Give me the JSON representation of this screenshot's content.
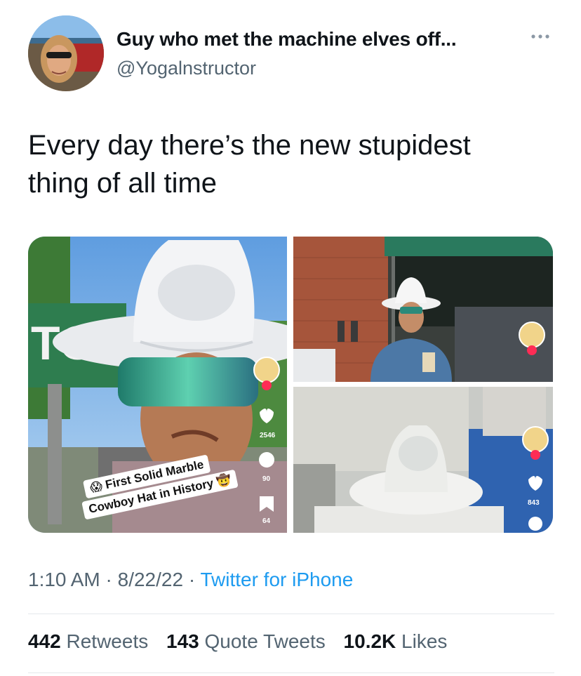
{
  "author": {
    "display_name": "Guy who met the machine elves off...",
    "handle": "@Yogalnstructor",
    "avatar_icon": "profile-photo"
  },
  "more_icon": "ellipsis-icon",
  "tweet": {
    "text_line1": "Every day there’s the new stupidest",
    "text_line2": "thing of all time"
  },
  "media": {
    "image1": {
      "sign_text": "TOW",
      "caption_line1": "First Solid Marble",
      "caption_line2": "Cowboy Hat in History",
      "caption_emoji_left": "😱",
      "caption_emoji_right": "🤠",
      "likes_count": "2546",
      "comments_count": "90",
      "saves_count": "64"
    },
    "image2": {
      "store_sign": ""
    },
    "image3": {
      "likes_count": "843"
    }
  },
  "meta": {
    "time": "1:10 AM",
    "sep1": " · ",
    "date": "8/22/22",
    "sep2": " · ",
    "source": "Twitter for iPhone"
  },
  "stats": {
    "retweets_count": "442",
    "retweets_label": "Retweets",
    "quotes_count": "143",
    "quotes_label": "Quote Tweets",
    "likes_count": "10.2K",
    "likes_label": "Likes"
  },
  "colors": {
    "text": "#0f1419",
    "secondary": "#536471",
    "link": "#1d9bf0",
    "divider": "#e4e8eb"
  }
}
